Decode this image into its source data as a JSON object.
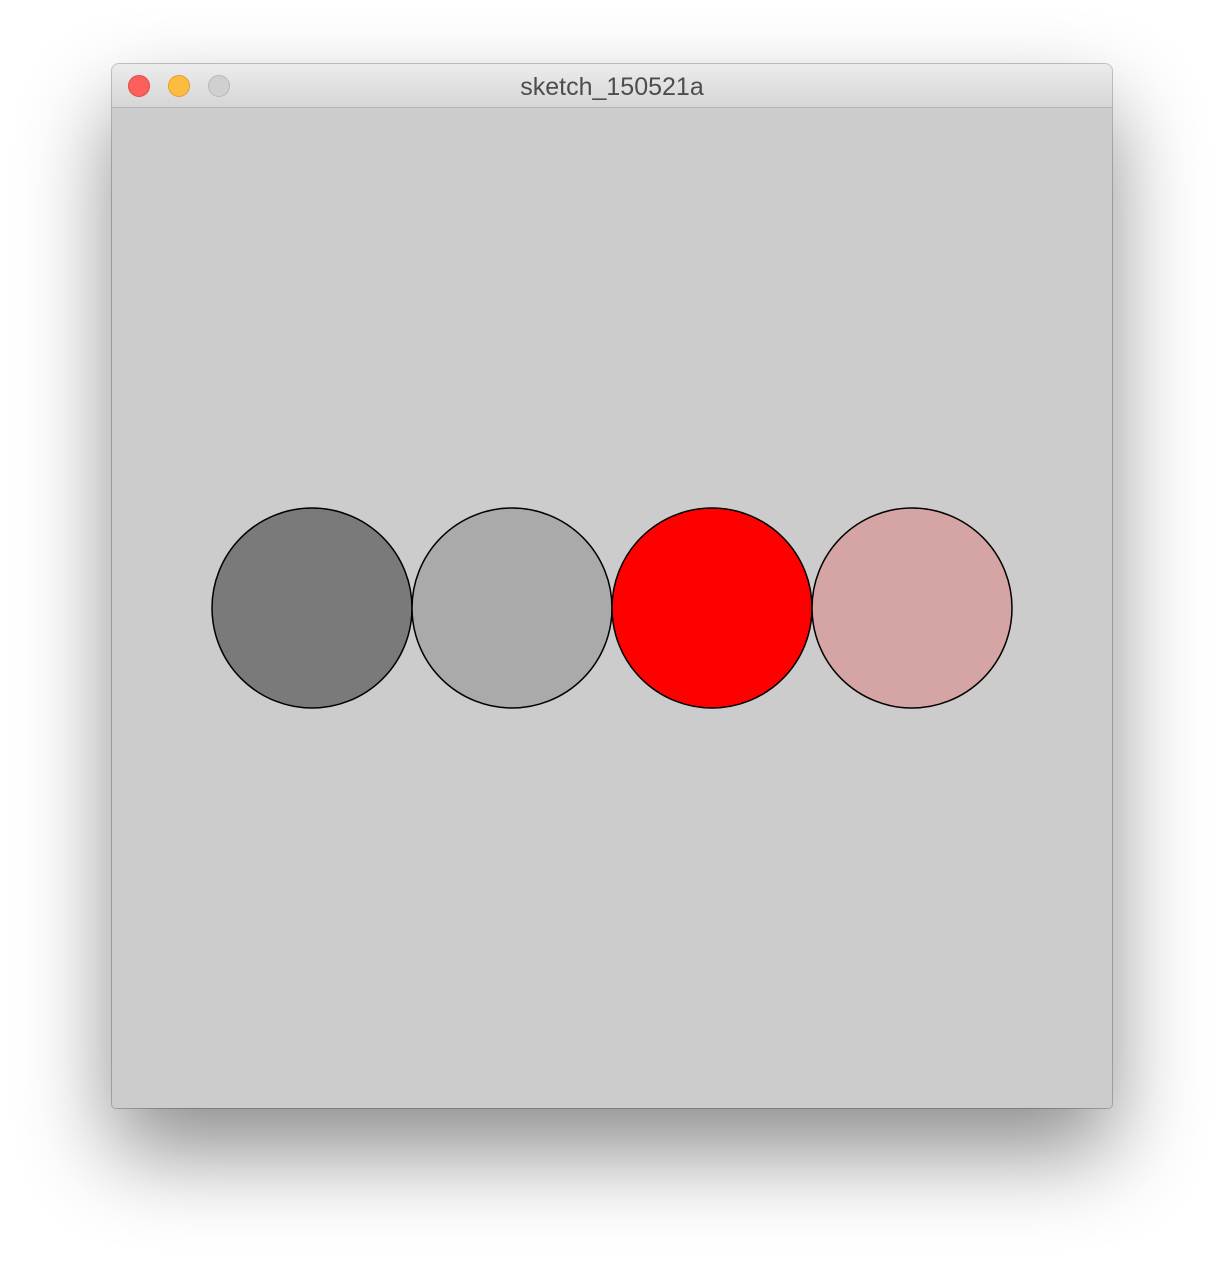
{
  "window": {
    "title": "sketch_150521a",
    "controls": [
      "close",
      "minimize",
      "zoom"
    ]
  },
  "canvas": {
    "background": "#cccccc",
    "stroke": "#000000",
    "circles": [
      {
        "name": "circle-dark-gray",
        "fill": "#7a7a7a"
      },
      {
        "name": "circle-light-gray",
        "fill": "#aaaaaa"
      },
      {
        "name": "circle-red",
        "fill": "#ff0000"
      },
      {
        "name": "circle-pink",
        "fill": "#d5a4a4"
      }
    ]
  }
}
